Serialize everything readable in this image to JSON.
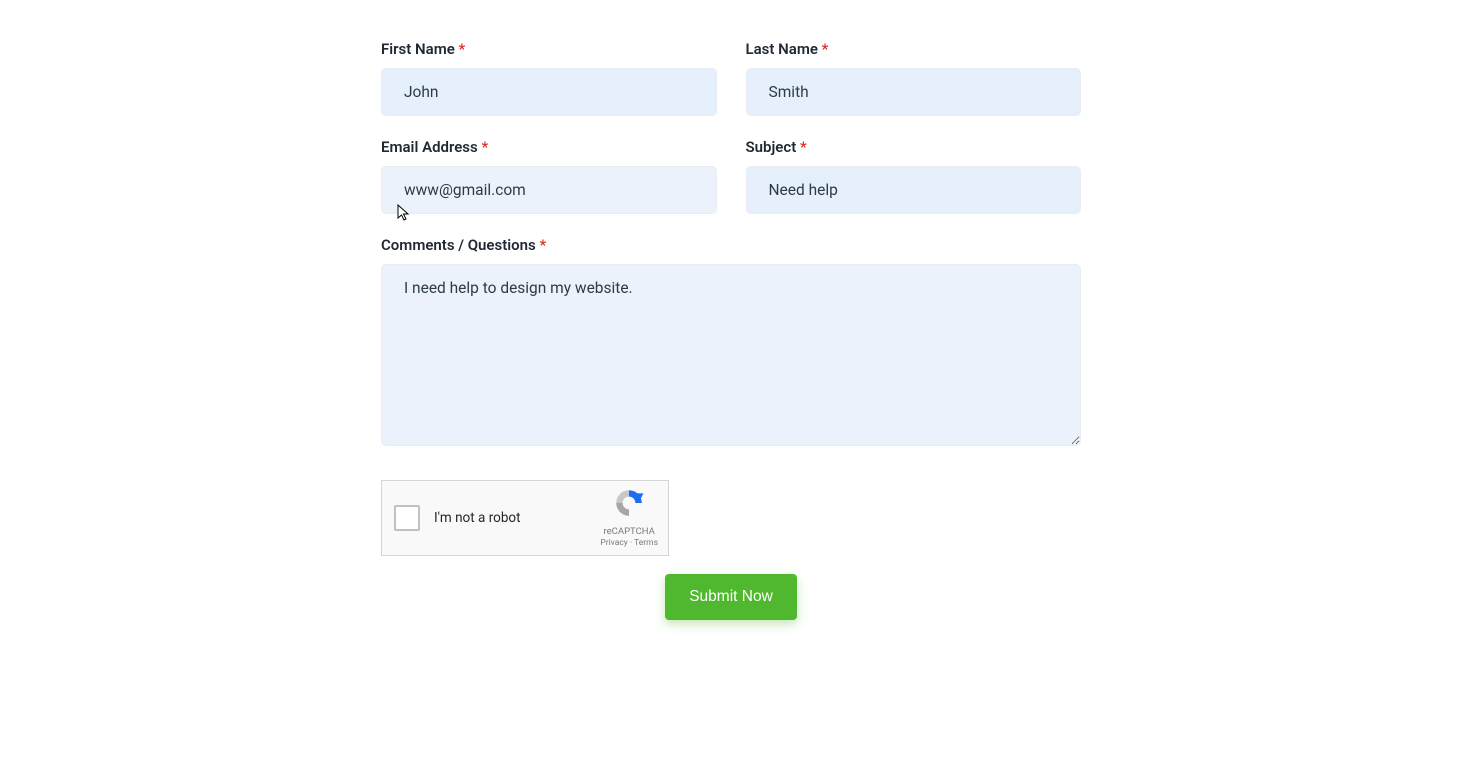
{
  "form": {
    "first_name": {
      "label": "First Name",
      "value": "John"
    },
    "last_name": {
      "label": "Last Name",
      "value": "Smith"
    },
    "email": {
      "label": "Email Address",
      "value": "www@gmail.com"
    },
    "subject": {
      "label": "Subject",
      "value": "Need help"
    },
    "comments": {
      "label": "Comments / Questions",
      "value": "I need help to design my website."
    }
  },
  "captcha": {
    "text": "I'm not a robot",
    "brand": "reCAPTCHA",
    "links": "Privacy  ·  Terms"
  },
  "submit_label": "Submit Now",
  "required_mark": "*"
}
